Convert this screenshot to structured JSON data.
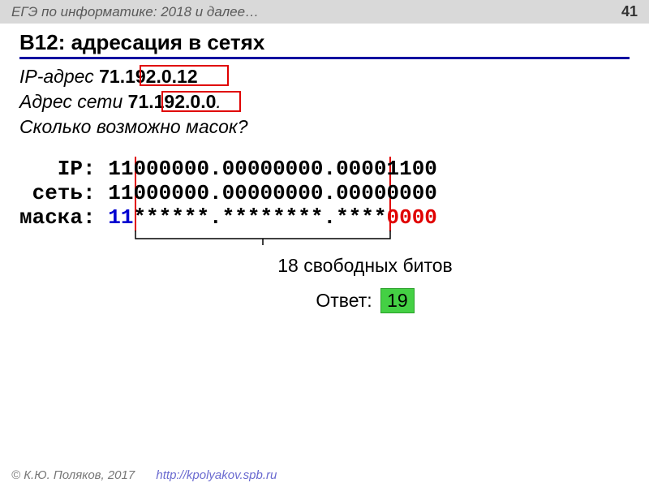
{
  "header": {
    "subject": "ЕГЭ по информатике: 2018 и далее…",
    "page": "41"
  },
  "title": "B12: адресация в сетях",
  "ip_label": "IP-адрес  ",
  "ip_value": "71.192.0.12",
  "net_label": "Адрес сети ",
  "net_value_pre": "71.",
  "net_value_box": "192.0.0",
  "net_value_post": ".",
  "question": "Сколько возможно масок?",
  "binary": {
    "ip_label": "   IP: ",
    "ip_p1": "11",
    "ip_p2": "000000.00000000.0000",
    "ip_p3": "1100",
    "net_label": " сеть: ",
    "net_p1": "11",
    "net_p2": "000000.00000000.0000",
    "net_p3": "0000",
    "mask_label": "маска: ",
    "mask_p1": "11",
    "mask_p2": "******.********.****",
    "mask_p3": "0000"
  },
  "caption": "18 свободных битов",
  "answer_label": "Ответ:",
  "answer_value": "19",
  "footer": {
    "copyright": "© К.Ю. Поляков, 2017",
    "link": "http://kpolyakov.spb.ru"
  }
}
